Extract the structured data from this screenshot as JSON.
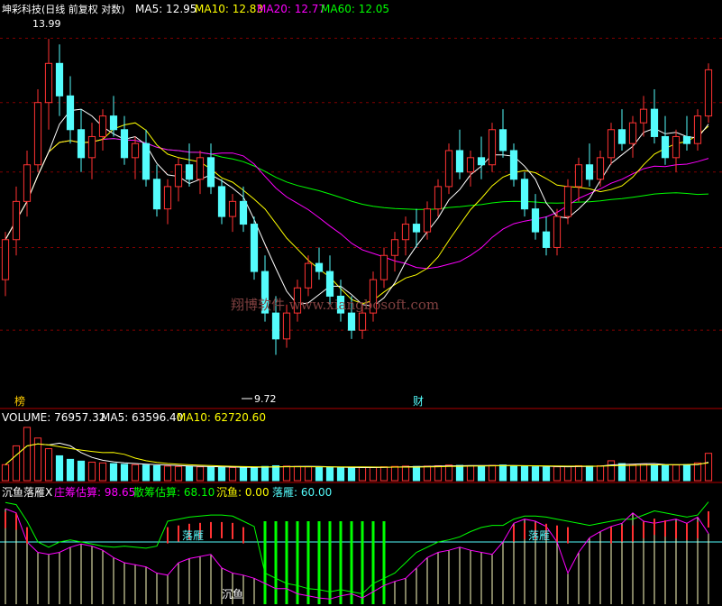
{
  "main": {
    "stock_label": "坤彩科技(日线 前复权 对数)",
    "ma": [
      {
        "label": "MA5: 12.95",
        "color": "#ffffff"
      },
      {
        "label": "MA10: 12.83",
        "color": "#ffff00"
      },
      {
        "label": "MA20: 12.77",
        "color": "#ff00ff"
      },
      {
        "label": "MA60: 12.05",
        "color": "#00ff00"
      }
    ],
    "high_label": "13.99",
    "low_label": "9.72",
    "tag_left": "榜",
    "tag_mid": "财",
    "watermark": "翔博软件 www.xiangbosoft.com"
  },
  "volume": {
    "title": "VOLUME: 76957.32",
    "ma5": "MA5: 63596.40",
    "ma10": "MA10: 62720.60"
  },
  "indicator": {
    "name": "沉鱼落雁X",
    "zhuang": "庄筹估算: 98.65",
    "san": "散筹估算: 68.10",
    "chenyu": "沉鱼: 0.00",
    "luoyan": "落雁: 60.00",
    "ann_luoyan_1": "落雁",
    "ann_luoyan_2": "落雁",
    "ann_chenyu": "沉鱼"
  },
  "colors": {
    "up": "#ff3232",
    "down": "#54fcfc",
    "ma5": "#ffffff",
    "ma10": "#ffff00",
    "ma20": "#ff00ff",
    "ma60": "#00ff00",
    "grid": "#800000"
  },
  "chart_data": {
    "type": "candlestick",
    "scale": "log",
    "ylim": [
      9.3,
      14.3
    ],
    "candles": [
      [
        10.6,
        11.2,
        10.4,
        11.1
      ],
      [
        11.1,
        11.8,
        10.9,
        11.6
      ],
      [
        11.6,
        12.3,
        11.4,
        12.1
      ],
      [
        12.1,
        13.2,
        12.0,
        13.0
      ],
      [
        13.0,
        13.99,
        12.6,
        13.6
      ],
      [
        13.6,
        13.9,
        12.8,
        13.1
      ],
      [
        13.1,
        13.4,
        12.4,
        12.6
      ],
      [
        12.6,
        12.9,
        12.0,
        12.2
      ],
      [
        12.2,
        12.7,
        11.9,
        12.5
      ],
      [
        12.5,
        12.9,
        12.3,
        12.8
      ],
      [
        12.8,
        13.1,
        12.5,
        12.6
      ],
      [
        12.6,
        12.8,
        12.1,
        12.2
      ],
      [
        12.2,
        12.5,
        11.9,
        12.4
      ],
      [
        12.4,
        12.6,
        11.8,
        11.9
      ],
      [
        11.9,
        12.1,
        11.4,
        11.5
      ],
      [
        11.5,
        11.9,
        11.3,
        11.8
      ],
      [
        11.8,
        12.2,
        11.6,
        12.1
      ],
      [
        12.1,
        12.4,
        11.8,
        11.9
      ],
      [
        11.9,
        12.3,
        11.7,
        12.2
      ],
      [
        12.2,
        12.4,
        11.7,
        11.8
      ],
      [
        11.8,
        11.9,
        11.3,
        11.4
      ],
      [
        11.4,
        11.7,
        11.2,
        11.6
      ],
      [
        11.6,
        11.8,
        11.2,
        11.3
      ],
      [
        11.3,
        11.4,
        10.6,
        10.7
      ],
      [
        10.7,
        10.9,
        10.1,
        10.2
      ],
      [
        10.2,
        10.4,
        9.72,
        9.9
      ],
      [
        9.9,
        10.3,
        9.8,
        10.2
      ],
      [
        10.2,
        10.6,
        10.1,
        10.5
      ],
      [
        10.5,
        10.9,
        10.4,
        10.8
      ],
      [
        10.8,
        11.0,
        10.6,
        10.7
      ],
      [
        10.7,
        10.9,
        10.3,
        10.4
      ],
      [
        10.4,
        10.6,
        10.1,
        10.2
      ],
      [
        10.2,
        10.4,
        9.9,
        10.0
      ],
      [
        10.0,
        10.3,
        9.9,
        10.2
      ],
      [
        10.2,
        10.7,
        10.1,
        10.6
      ],
      [
        10.6,
        11.0,
        10.5,
        10.9
      ],
      [
        10.9,
        11.2,
        10.7,
        11.1
      ],
      [
        11.1,
        11.4,
        10.9,
        11.3
      ],
      [
        11.3,
        11.5,
        11.0,
        11.2
      ],
      [
        11.2,
        11.6,
        11.1,
        11.5
      ],
      [
        11.5,
        11.9,
        11.4,
        11.8
      ],
      [
        11.8,
        12.4,
        11.7,
        12.3
      ],
      [
        12.3,
        12.6,
        11.9,
        12.0
      ],
      [
        12.0,
        12.3,
        11.8,
        12.2
      ],
      [
        12.2,
        12.5,
        11.9,
        12.1
      ],
      [
        12.1,
        12.7,
        12.0,
        12.6
      ],
      [
        12.6,
        12.9,
        12.2,
        12.3
      ],
      [
        12.3,
        12.4,
        11.8,
        11.9
      ],
      [
        11.9,
        12.0,
        11.4,
        11.5
      ],
      [
        11.5,
        11.7,
        11.1,
        11.2
      ],
      [
        11.2,
        11.4,
        10.9,
        11.0
      ],
      [
        11.0,
        11.5,
        10.9,
        11.4
      ],
      [
        11.4,
        11.9,
        11.3,
        11.8
      ],
      [
        11.8,
        12.2,
        11.6,
        12.1
      ],
      [
        12.1,
        12.4,
        11.8,
        11.9
      ],
      [
        11.9,
        12.3,
        11.8,
        12.2
      ],
      [
        12.2,
        12.7,
        12.1,
        12.6
      ],
      [
        12.6,
        12.9,
        12.3,
        12.4
      ],
      [
        12.4,
        12.8,
        12.2,
        12.7
      ],
      [
        12.7,
        13.1,
        12.5,
        12.9
      ],
      [
        12.9,
        13.2,
        12.4,
        12.5
      ],
      [
        12.5,
        12.8,
        12.1,
        12.2
      ],
      [
        12.2,
        12.6,
        12.0,
        12.5
      ],
      [
        12.5,
        12.8,
        12.3,
        12.4
      ],
      [
        12.4,
        12.9,
        12.3,
        12.8
      ],
      [
        12.8,
        13.6,
        12.7,
        13.5
      ]
    ],
    "volume": [
      45000,
      98000,
      150000,
      120000,
      90000,
      70000,
      60000,
      55000,
      52000,
      50000,
      48000,
      46000,
      45000,
      44000,
      42000,
      41000,
      40000,
      40000,
      39000,
      38000,
      38000,
      37000,
      37000,
      38000,
      40000,
      42000,
      41000,
      40000,
      39000,
      38000,
      37000,
      36000,
      36000,
      37000,
      38000,
      39000,
      40000,
      41000,
      40000,
      41000,
      42000,
      44000,
      43000,
      42000,
      41000,
      43000,
      44000,
      42000,
      40000,
      39000,
      38000,
      39000,
      40000,
      42000,
      41000,
      42000,
      56000,
      48000,
      45000,
      47000,
      44000,
      43000,
      44000,
      45000,
      50000,
      76957
    ],
    "zhuang": [
      98,
      96,
      80,
      60,
      55,
      60,
      62,
      60,
      58,
      56,
      55,
      56,
      55,
      54,
      56,
      80,
      82,
      84,
      85,
      86,
      86,
      85,
      80,
      75,
      30,
      25,
      20,
      18,
      15,
      14,
      12,
      14,
      12,
      10,
      20,
      25,
      30,
      40,
      50,
      55,
      60,
      62,
      65,
      70,
      74,
      76,
      76,
      82,
      85,
      85,
      84,
      82,
      80,
      78,
      76,
      78,
      80,
      82,
      82,
      86,
      90,
      88,
      86,
      84,
      86,
      98.65
    ],
    "san": [
      92,
      88,
      60,
      50,
      48,
      50,
      55,
      58,
      56,
      52,
      45,
      40,
      38,
      36,
      30,
      28,
      40,
      44,
      46,
      48,
      35,
      30,
      28,
      25,
      20,
      15,
      15,
      10,
      8,
      6,
      5,
      8,
      10,
      6,
      12,
      18,
      22,
      25,
      35,
      45,
      50,
      52,
      55,
      52,
      50,
      48,
      60,
      78,
      82,
      80,
      75,
      60,
      30,
      50,
      64,
      70,
      75,
      78,
      88,
      80,
      78,
      80,
      82,
      78,
      84,
      68.1
    ],
    "chenyu": [
      0,
      0,
      0,
      0,
      0,
      0,
      0,
      0,
      0,
      0,
      0,
      0,
      0,
      0,
      0,
      0,
      0,
      0,
      0,
      0,
      0,
      0,
      0,
      0,
      1,
      1,
      1,
      1,
      1,
      1,
      1,
      1,
      1,
      1,
      1,
      1,
      0,
      0,
      0,
      0,
      0,
      0,
      0,
      0,
      0,
      0,
      0,
      0,
      0,
      0,
      0,
      0,
      0,
      0,
      0,
      0,
      0,
      0,
      0,
      0,
      0,
      0,
      0,
      0,
      0,
      0.0
    ],
    "luoyan": 60.0
  }
}
